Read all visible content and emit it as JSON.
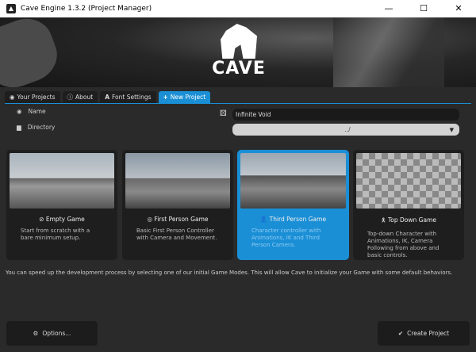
{
  "window": {
    "title": "Cave Engine 1.3.2 (Project Manager)",
    "minimize": "—",
    "maximize": "☐",
    "close": "✕"
  },
  "banner": {
    "logo_text": "CAVE"
  },
  "tabs": [
    {
      "label": "Your Projects",
      "icon": "compass-icon"
    },
    {
      "label": "About",
      "icon": "info-icon"
    },
    {
      "label": "Font Settings",
      "icon": "font-icon"
    },
    {
      "label": "New Project",
      "icon": "plus-icon",
      "active": true
    }
  ],
  "form": {
    "name_label": "Name",
    "name_value": "Infinite Void",
    "directory_label": "Directory",
    "directory_value": "../"
  },
  "templates": [
    {
      "title": "Empty Game",
      "icon": "ban-icon",
      "description": "Start from scratch with a bare minimum setup."
    },
    {
      "title": "First Person Game",
      "icon": "eye-icon",
      "description": "Basic First Person Controller with Camera and Movement."
    },
    {
      "title": "Third Person Game",
      "icon": "user-icon",
      "description": "Character controller with Animations, IK and Third Person Camera.",
      "selected": true
    },
    {
      "title": "Top Down Game",
      "icon": "person-icon",
      "description": "Top-down Character with Animations, IK, Camera Following from above and basic controls."
    }
  ],
  "hint": "You can speed up the development process by selecting one of our initial Game Modes. This will allow Cave to initialize your Game with some default behaviors.",
  "buttons": {
    "options": "Options...",
    "create": "Create Project"
  },
  "colors": {
    "accent": "#1a8fd6",
    "background": "#2a2a2a",
    "card": "#1e1e1e"
  }
}
